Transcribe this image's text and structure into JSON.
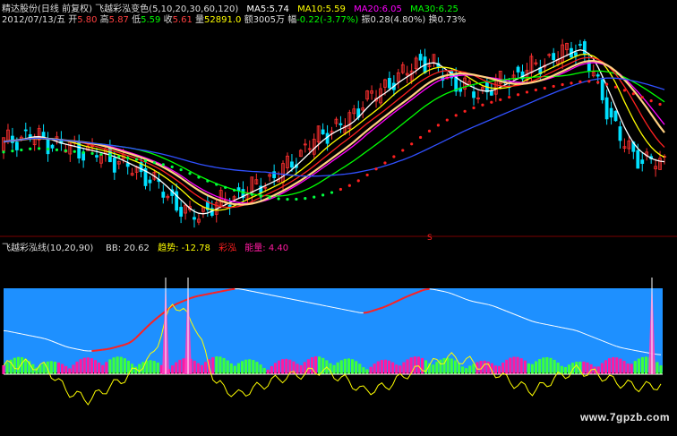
{
  "header": {
    "stock_name": "精达股份(日线 前复权)",
    "indicator_name": "飞越彩泓变色(5,10,20,30,60,120)",
    "ma5_label": "MA5:",
    "ma5_value": "5.74",
    "ma10_label": "MA10:",
    "ma10_value": "5.59",
    "ma20_label": "MA20:",
    "ma20_value": "6.05",
    "ma30_label": "MA30:",
    "ma30_value": "6.25",
    "date": "2012/07/13/五",
    "open_label": "开",
    "open_value": "5.80",
    "high_label": "高",
    "high_value": "5.87",
    "low_label": "低",
    "low_value": "5.59",
    "close_label": "收",
    "close_value": "5.61",
    "volume_label": "量",
    "volume_value": "52891.0",
    "amount_label": "额",
    "amount_value": "3005万",
    "change_label": "幅",
    "change_value": "-0.22(-3.77%)",
    "amplitude_label": "振",
    "amplitude_value": "0.28(4.80%)",
    "turnover_label": "换",
    "turnover_value": "0.73%"
  },
  "indicator": {
    "title": "飞越彩泓线(10,20,90)",
    "bb_label": "BB:",
    "bb_value": "20.62",
    "trend_label": "趋势:",
    "trend_value": "-12.78",
    "caihong_label": "彩泓",
    "energy_label": "能量:",
    "energy_value": "4.40",
    "s_marker": "S"
  },
  "watermark": "www.7gpzb.com",
  "colors": {
    "ma5": "#ffffff",
    "ma10": "#ffff00",
    "ma20": "#ff00ff",
    "ma30": "#00ff00",
    "open": "#ff4040",
    "high": "#ff4040",
    "low": "#00ff00",
    "close": "#ff4040",
    "volume": "#ffff00",
    "change": "#00ff00",
    "band": "#1e90ff",
    "bar_green": "#3cff3c",
    "bar_pink": "#ff1aa0"
  },
  "chart_data": [
    {
      "type": "candlestick",
      "description_series": [
        {
          "name": "MA5",
          "color": "#ffffff"
        },
        {
          "name": "MA10",
          "color": "#ffff00"
        },
        {
          "name": "MA20",
          "color": "#ff00ff"
        },
        {
          "name": "MA30",
          "color": "#00ff00"
        }
      ],
      "close_approx": [
        5.9,
        5.95,
        6.0,
        5.9,
        5.85,
        5.8,
        5.75,
        5.7,
        5.6,
        5.5,
        5.4,
        5.2,
        5.0,
        4.8,
        4.9,
        5.0,
        5.1,
        5.2,
        5.3,
        5.4,
        5.6,
        5.8,
        6.0,
        6.1,
        6.2,
        6.5,
        6.6,
        6.8,
        6.9,
        7.1,
        7.0,
        6.8,
        6.7,
        6.6,
        6.7,
        6.8,
        6.9,
        7.0,
        7.1,
        7.2,
        7.3,
        6.9,
        6.4,
        5.9,
        5.7,
        5.6,
        5.61
      ]
    },
    {
      "type": "line",
      "trend_approx": [
        10,
        12,
        8,
        -20,
        -30,
        -15,
        0,
        20,
        85,
        60,
        -10,
        -25,
        -15,
        -5,
        0,
        5,
        -5,
        -20,
        -15,
        0,
        10,
        20,
        15,
        5,
        -10,
        -20,
        -5,
        5,
        0,
        -10,
        -15,
        -12.78
      ],
      "bb_approx": [
        50,
        45,
        40,
        30,
        25,
        28,
        35,
        60,
        80,
        90,
        95,
        100,
        95,
        90,
        85,
        80,
        75,
        70,
        78,
        90,
        100,
        95,
        85,
        80,
        70,
        60,
        55,
        50,
        40,
        30,
        25,
        20.62
      ]
    }
  ]
}
